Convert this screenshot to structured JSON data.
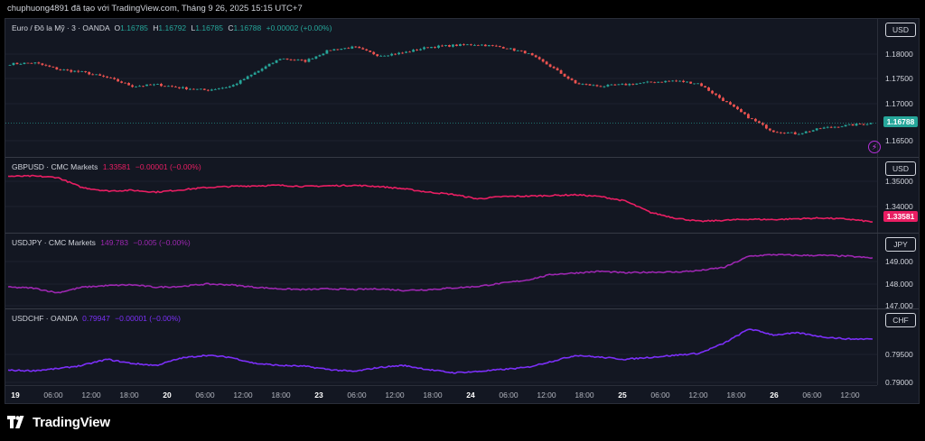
{
  "caption": "chuphuong4891 đã tạo với TradingView.com, Tháng 9 26, 2025 15:15 UTC+7",
  "brand": "TradingView",
  "panes": [
    {
      "symbol": "Euro / Đô la Mỹ · 3 · OANDA",
      "ohlc": {
        "o_label": "O",
        "o": "1.16785",
        "h_label": "H",
        "h": "1.16792",
        "l_label": "L",
        "l": "1.16785",
        "c_label": "C",
        "c": "1.16788",
        "chg": "+0.00002 (+0.00%)"
      },
      "currency": "USD",
      "ticks": [
        "1.18000",
        "1.17500",
        "1.17000",
        "1.16500"
      ],
      "last_price": "1.16788",
      "color": "#26a69a"
    },
    {
      "symbol": "GBPUSD · CMC Markets",
      "value": "1.33581",
      "chg": "−0.00001 (−0.00%)",
      "currency": "USD",
      "ticks": [
        "1.35000",
        "1.34000"
      ],
      "last_price": "1.33581",
      "color": "#e91e63"
    },
    {
      "symbol": "USDJPY · CMC Markets",
      "value": "149.783",
      "chg": "−0.005 (−0.00%)",
      "currency": "JPY",
      "ticks": [
        "149.000",
        "148.000",
        "147.000"
      ],
      "color": "#9c27b0"
    },
    {
      "symbol": "USDCHF · OANDA",
      "value": "0.79947",
      "chg": "−0.00001 (−0.00%)",
      "currency": "CHF",
      "ticks": [
        "0.79500",
        "0.79000"
      ],
      "color": "#7b2ff7"
    }
  ],
  "time_axis": [
    "19",
    "06:00",
    "12:00",
    "18:00",
    "20",
    "06:00",
    "12:00",
    "18:00",
    "23",
    "06:00",
    "12:00",
    "18:00",
    "24",
    "06:00",
    "12:00",
    "18:00",
    "25",
    "06:00",
    "12:00",
    "18:00",
    "26",
    "06:00",
    "12:00"
  ],
  "day_labels": [
    "19",
    "20",
    "23",
    "24",
    "25",
    "26"
  ],
  "chart_data": [
    {
      "type": "candlestick",
      "title": "Euro / Đô la Mỹ · 3 · OANDA",
      "x_dates": [
        "19",
        "20",
        "23",
        "24",
        "25",
        "26"
      ],
      "ylim": [
        1.163,
        1.183
      ],
      "series": [
        {
          "name": "EURUSD",
          "values": [
            1.1785,
            1.1787,
            1.1775,
            1.177,
            1.176,
            1.1745,
            1.1748,
            1.1742,
            1.1738,
            1.1745,
            1.177,
            1.1795,
            1.179,
            1.181,
            1.1815,
            1.18,
            1.1805,
            1.1815,
            1.1818,
            1.182,
            1.1815,
            1.1805,
            1.178,
            1.175,
            1.1745,
            1.1748,
            1.1752,
            1.1755,
            1.175,
            1.172,
            1.169,
            1.1665,
            1.166,
            1.167,
            1.1675,
            1.1679
          ]
        }
      ]
    },
    {
      "type": "line",
      "title": "GBPUSD · CMC Markets",
      "x_dates": [
        "19",
        "20",
        "23",
        "24",
        "25",
        "26"
      ],
      "ylim": [
        1.333,
        1.357
      ],
      "series": [
        {
          "name": "GBPUSD",
          "values": [
            1.356,
            1.3561,
            1.3555,
            1.351,
            1.3495,
            1.3498,
            1.349,
            1.35,
            1.351,
            1.3515,
            1.3518,
            1.352,
            1.3515,
            1.3518,
            1.352,
            1.3515,
            1.3505,
            1.349,
            1.348,
            1.346,
            1.347,
            1.3472,
            1.3475,
            1.3478,
            1.347,
            1.345,
            1.34,
            1.3375,
            1.336,
            1.3365,
            1.337,
            1.3368,
            1.3372,
            1.3375,
            1.337,
            1.3358
          ]
        }
      ]
    },
    {
      "type": "line",
      "title": "USDJPY · CMC Markets",
      "x_dates": [
        "19",
        "20",
        "23",
        "24",
        "25",
        "26"
      ],
      "ylim": [
        146.9,
        150.3
      ],
      "series": [
        {
          "name": "USDJPY",
          "values": [
            147.95,
            147.9,
            147.6,
            147.95,
            148.05,
            148.1,
            147.95,
            148.0,
            148.15,
            148.1,
            147.95,
            147.85,
            147.8,
            147.85,
            147.8,
            147.85,
            147.75,
            147.8,
            147.9,
            148.0,
            148.2,
            148.4,
            148.75,
            148.85,
            148.95,
            148.85,
            148.9,
            148.9,
            149.0,
            149.2,
            149.9,
            150.0,
            149.95,
            149.95,
            149.9,
            149.78
          ]
        }
      ]
    },
    {
      "type": "line",
      "title": "USDCHF · OANDA",
      "x_dates": [
        "19",
        "20",
        "23",
        "24",
        "25",
        "26"
      ],
      "ylim": [
        0.7895,
        0.8028
      ],
      "series": [
        {
          "name": "USDCHF",
          "values": [
            0.7918,
            0.7917,
            0.7922,
            0.793,
            0.7945,
            0.7935,
            0.793,
            0.7948,
            0.7955,
            0.795,
            0.7935,
            0.793,
            0.7928,
            0.792,
            0.7915,
            0.7925,
            0.793,
            0.792,
            0.7912,
            0.7915,
            0.792,
            0.7925,
            0.794,
            0.7955,
            0.795,
            0.7945,
            0.795,
            0.7955,
            0.796,
            0.7985,
            0.802,
            0.8005,
            0.801,
            0.8,
            0.7995,
            0.7995
          ]
        }
      ]
    }
  ]
}
